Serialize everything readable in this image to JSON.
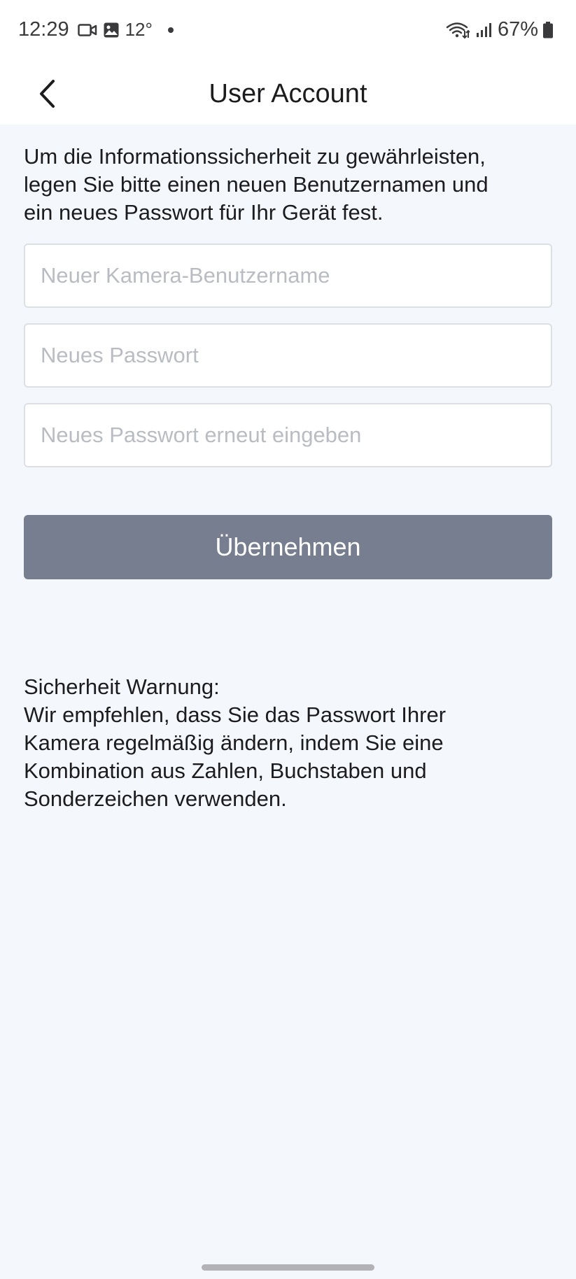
{
  "status_bar": {
    "time": "12:29",
    "temperature": "12°",
    "battery": "67%",
    "icons": [
      "video-icon",
      "image-icon",
      "notification-dot",
      "wifi-icon",
      "signal-icon",
      "battery-icon"
    ]
  },
  "header": {
    "title": "User Account",
    "back_icon": "chevron-left-icon"
  },
  "intro": {
    "line1": "Um die Informationssicherheit zu gewährleisten,",
    "line2": "legen Sie bitte einen neuen Benutzernamen und",
    "line3": "ein neues Passwort für Ihr Gerät fest."
  },
  "form": {
    "username": {
      "placeholder": "Neuer Kamera-Benutzername",
      "value": ""
    },
    "password": {
      "placeholder": "Neues Passwort",
      "value": ""
    },
    "password_confirm": {
      "placeholder": "Neues Passwort erneut eingeben",
      "value": ""
    },
    "submit_label": "Übernehmen"
  },
  "warning": {
    "title": "Sicherheit Warnung:",
    "line1": "Wir empfehlen, dass Sie das Passwort Ihrer",
    "line2": "Kamera regelmäßig ändern, indem Sie eine",
    "line3": "Kombination aus Zahlen, Buchstaben und",
    "line4": "Sonderzeichen verwenden."
  },
  "colors": {
    "background": "#f4f7fc",
    "button": "#767e90",
    "field_border": "#dcdfe4",
    "placeholder": "#b9bcc2"
  }
}
